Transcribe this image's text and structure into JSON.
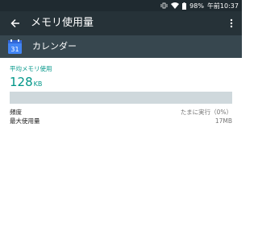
{
  "status_bar": {
    "battery": "98%",
    "time": "午前10:37"
  },
  "app_bar": {
    "title": "メモリ使用量"
  },
  "app_row": {
    "name": "カレンダー",
    "icon_text": "31"
  },
  "memory": {
    "avg_label": "平均メモリ使用",
    "avg_value": "128",
    "avg_unit": "KB",
    "usage_fraction": 0.0
  },
  "details": [
    {
      "label": "頻度",
      "value": "たまに実行（0%）"
    },
    {
      "label": "最大使用量",
      "value": "17MB"
    }
  ],
  "colors": {
    "accent": "#009688",
    "appbar": "#263238",
    "approw": "#37474f",
    "bar_bg": "#cfd8dc"
  }
}
